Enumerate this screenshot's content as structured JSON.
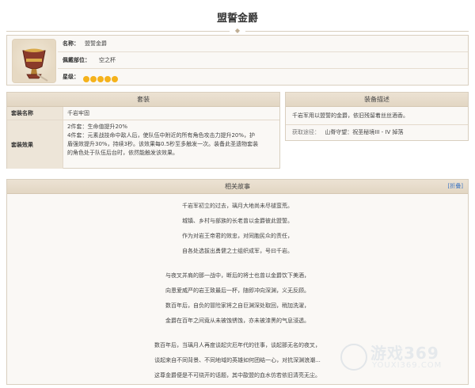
{
  "page": {
    "title": "盟誓金爵"
  },
  "info": {
    "name_label": "名称：",
    "name_value": "盟誓金爵",
    "slot_label": "佩戴部位：",
    "slot_value": "空之杯",
    "rarity_label": "星级：",
    "rarity_stars": 5,
    "star_color": "#f5b21b",
    "icon": "golden-goblet-icon"
  },
  "set_panel": {
    "header": "套装",
    "name_key": "套装名称",
    "name_value": "千岩牢固",
    "effect_key": "套装效果",
    "effect_lines": [
      "2件套：生命值提升20%",
      "4件套：元素战技命中敌人后，使队伍中附近的所有角色攻击力提升20%，护",
      "盾强效提升30%，持续3秒。该效果每0.5秒至多触发一次。装备此圣遗物套装",
      "的角色处于队伍后台时，依然能触发该效果。"
    ]
  },
  "desc_panel": {
    "header": "装备描述",
    "text": "千岩军用以盟誓的金爵，依旧残留着丝丝酒香。",
    "source_label": "获取途径：",
    "source_value": "山脊守望：祝圣秘境III - IV 掉落"
  },
  "story_panel": {
    "header": "相关故事",
    "fold_label": "[折叠]",
    "paragraphs": [
      [
        "千岩军初立的过去，璃月大地尚未尽褪蛮荒。",
        "城镇、乡村与部族的长老曾以金爵彼此盟誓。",
        "作为对岩王帝君的效忠，对同胞民众的责任，",
        "自各处选拔出勇健之士组织成军，号曰千岩。"
      ],
      [
        "与夜叉并肩的那一战中，断后的将士也曾以金爵饮下美酒，",
        "向恩爱威严的岩王致最后一杯，随即冲向深渊，义无反顾。",
        "数百年后，自负的冒险家将之自巨渊深处取回，稍加洗濯，",
        "金爵在百年之间竟从未被蚀锈蚀，亦未被漆黑的气息浸透。"
      ],
      [
        "数百年后，当璃月人再度谈起灾厄年代的往事，谈起那无名的夜叉，",
        "谈起来自不同背景、不同地域的英雄如何团结一心，对抗深渊浪潮...",
        "这尊金爵便是不可绕开的话题，其中歃盟的血水仿若依旧清亮无尘。"
      ]
    ]
  },
  "watermark": {
    "brand": "游戏369",
    "url": "YOUXI369.COM"
  }
}
